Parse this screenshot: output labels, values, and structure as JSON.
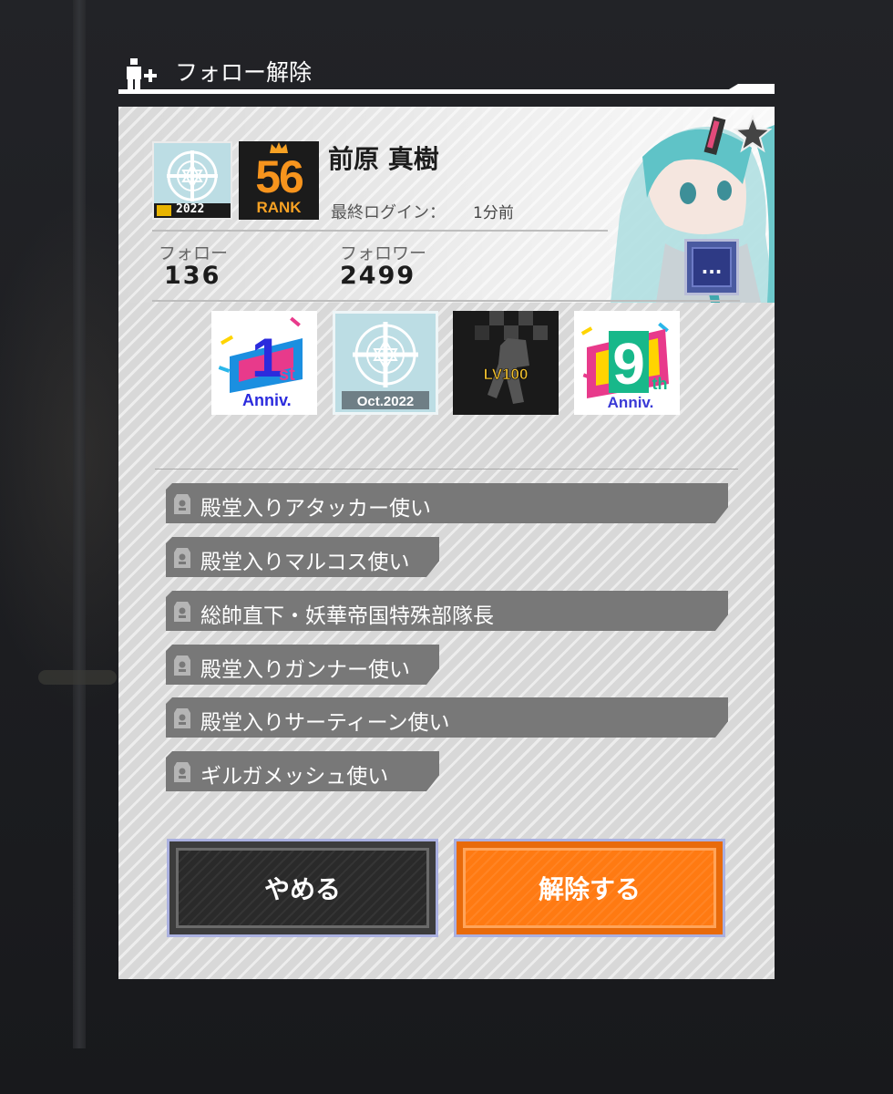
{
  "header": {
    "title": "フォロー解除"
  },
  "profile": {
    "emblem_year": "2022",
    "rank_number": "56",
    "rank_label": "RANK",
    "name": "前原 真樹",
    "last_login_label": "最終ログイン：",
    "last_login_value": "1分前",
    "follow_label": "フォロー",
    "follow_count": "136",
    "follower_label": "フォロワー",
    "follower_count": "2499",
    "more_button_label": "..."
  },
  "badges": [
    {
      "name": "1st Anniversary",
      "main": "1",
      "suffix": "st",
      "sub": "Anniv."
    },
    {
      "name": "Oct.2022",
      "main": "",
      "suffix": "",
      "sub": "Oct.2022"
    },
    {
      "name": "LV100",
      "main": "LV100",
      "suffix": "",
      "sub": ""
    },
    {
      "name": "9th Anniversary",
      "main": "9",
      "suffix": "th",
      "sub": "Anniv."
    }
  ],
  "titles": [
    "殿堂入りアタッカー使い",
    "殿堂入りマルコス使い",
    "総帥直下・妖華帝国特殊部隊長",
    "殿堂入りガンナー使い",
    "殿堂入りサーティーン使い",
    "ギルガメッシュ使い"
  ],
  "buttons": {
    "cancel": "やめる",
    "confirm": "解除する"
  },
  "colors": {
    "rank_orange": "#f7941d",
    "confirm_orange": "#ff7a12",
    "title_bar_gray": "#787878",
    "more_button_blue": "#2e3a85"
  }
}
